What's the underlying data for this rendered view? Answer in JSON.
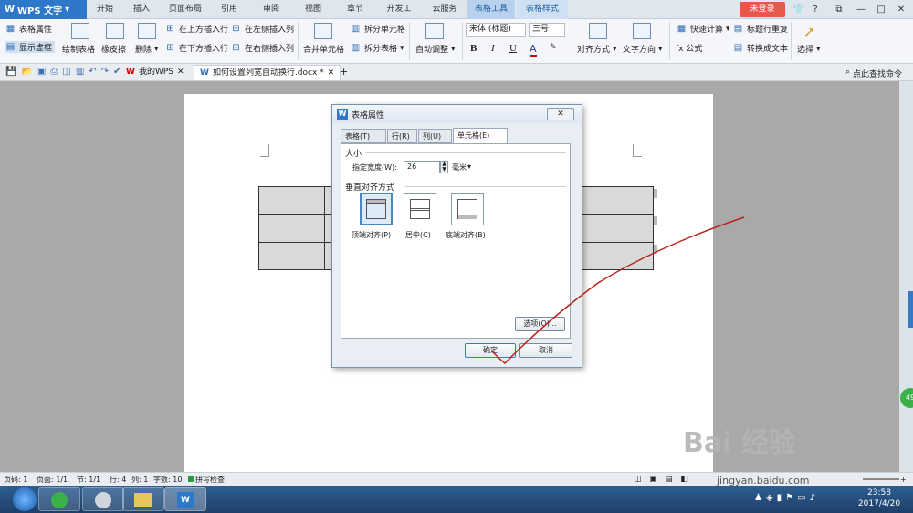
{
  "app": {
    "name": "WPS 文字",
    "login": "未登录"
  },
  "menu": [
    "开始",
    "插入",
    "页面布局",
    "引用",
    "审阅",
    "视图",
    "章节",
    "开发工具",
    "云服务",
    "表格工具",
    "表格样式"
  ],
  "ribbon": {
    "table_props": "表格属性",
    "show_grid": "显示虚框",
    "draw_table": "绘制表格",
    "eraser": "橡皮擦",
    "delete": "删除",
    "insert_above": "在上方插入行",
    "insert_below": "在下方插入行",
    "insert_left": "在左侧插入列",
    "insert_right": "在右侧插入列",
    "merge": "合并单元格",
    "split_cell": "拆分单元格",
    "split_table": "拆分表格",
    "autofit": "自动调整",
    "font": "宋体 (标题)",
    "size": "三号",
    "bold": "B",
    "italic": "I",
    "underline": "U",
    "font_color": "A",
    "align": "对齐方式",
    "text_dir": "文字方向",
    "quick_calc": "快速计算",
    "formula": "fx 公式",
    "repeat_header": "标题行重复",
    "to_text": "转换成文本",
    "select": "选择"
  },
  "doctabs": {
    "mywps": "我的WPS",
    "doc": "如何设置列宽自动换行.docx *",
    "search": "点此查找命令"
  },
  "dialog": {
    "title": "表格属性",
    "close": "✕",
    "tabs": [
      "表格(T)",
      "行(R)",
      "列(U)",
      "单元格(E)"
    ],
    "size_group": "大小",
    "width_label": "指定宽度(W):",
    "width_value": "26",
    "unit": "毫米",
    "valign_group": "垂直对齐方式",
    "valign_options": [
      "顶端对齐(P)",
      "居中(C)",
      "底端对齐(B)"
    ],
    "options_btn": "选项(O)...",
    "ok": "确定",
    "cancel": "取消"
  },
  "status": {
    "page": "页码: 1",
    "pages": "页面: 1/1",
    "section": "节: 1/1",
    "row": "行: 4",
    "col": "列: 1",
    "words": "字数: 10",
    "spell": "拼写检查"
  },
  "taskbar": {
    "time": "23:58",
    "date": "2017/4/20",
    "zoom": "49"
  },
  "watermark": {
    "text": "Bai 经验",
    "url": "jingyan.baidu.com"
  }
}
